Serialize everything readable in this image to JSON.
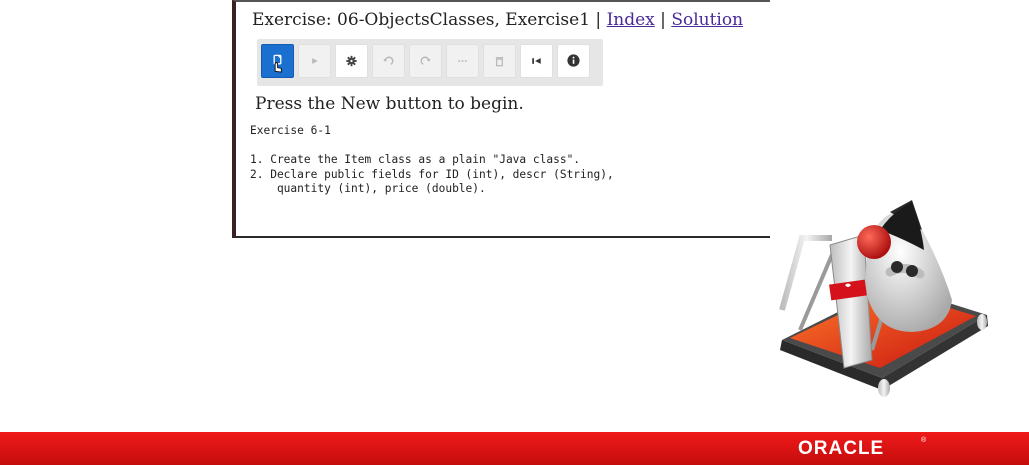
{
  "exercise": {
    "title_prefix": "Exercise: 06-ObjectsClasses, Exercise1 |",
    "index_link": "Index",
    "separator": "|",
    "solution_link": "Solution"
  },
  "toolbar": {
    "buttons": [
      {
        "name": "new-button",
        "icon": "new-document-icon",
        "state": "primary"
      },
      {
        "name": "run-button",
        "icon": "play-icon",
        "state": "disabled"
      },
      {
        "name": "settings-button",
        "icon": "gear-icon",
        "state": "enabled"
      },
      {
        "name": "undo-button",
        "icon": "undo-icon",
        "state": "disabled"
      },
      {
        "name": "redo-button",
        "icon": "redo-icon",
        "state": "disabled"
      },
      {
        "name": "dots-button",
        "icon": "ellipsis-icon",
        "state": "disabled"
      },
      {
        "name": "delete-button",
        "icon": "trash-icon",
        "state": "disabled"
      },
      {
        "name": "reset-button",
        "icon": "skip-back-icon",
        "state": "enabled"
      },
      {
        "name": "info-button",
        "icon": "info-icon",
        "state": "enabled"
      }
    ]
  },
  "instructions": {
    "press": "Press the New button to begin.",
    "console": "Exercise 6-1\n\n1. Create the Item class as a plain \"Java class\".\n2. Declare public fields for ID (int), descr (String),\n    quantity (int), price (double)."
  },
  "footer": {
    "logo": "ORACLE",
    "registered": "®"
  },
  "colors": {
    "primary_button": "#1a6fcf",
    "footer_red": "#e0120f",
    "link": "#4a2a9a"
  }
}
